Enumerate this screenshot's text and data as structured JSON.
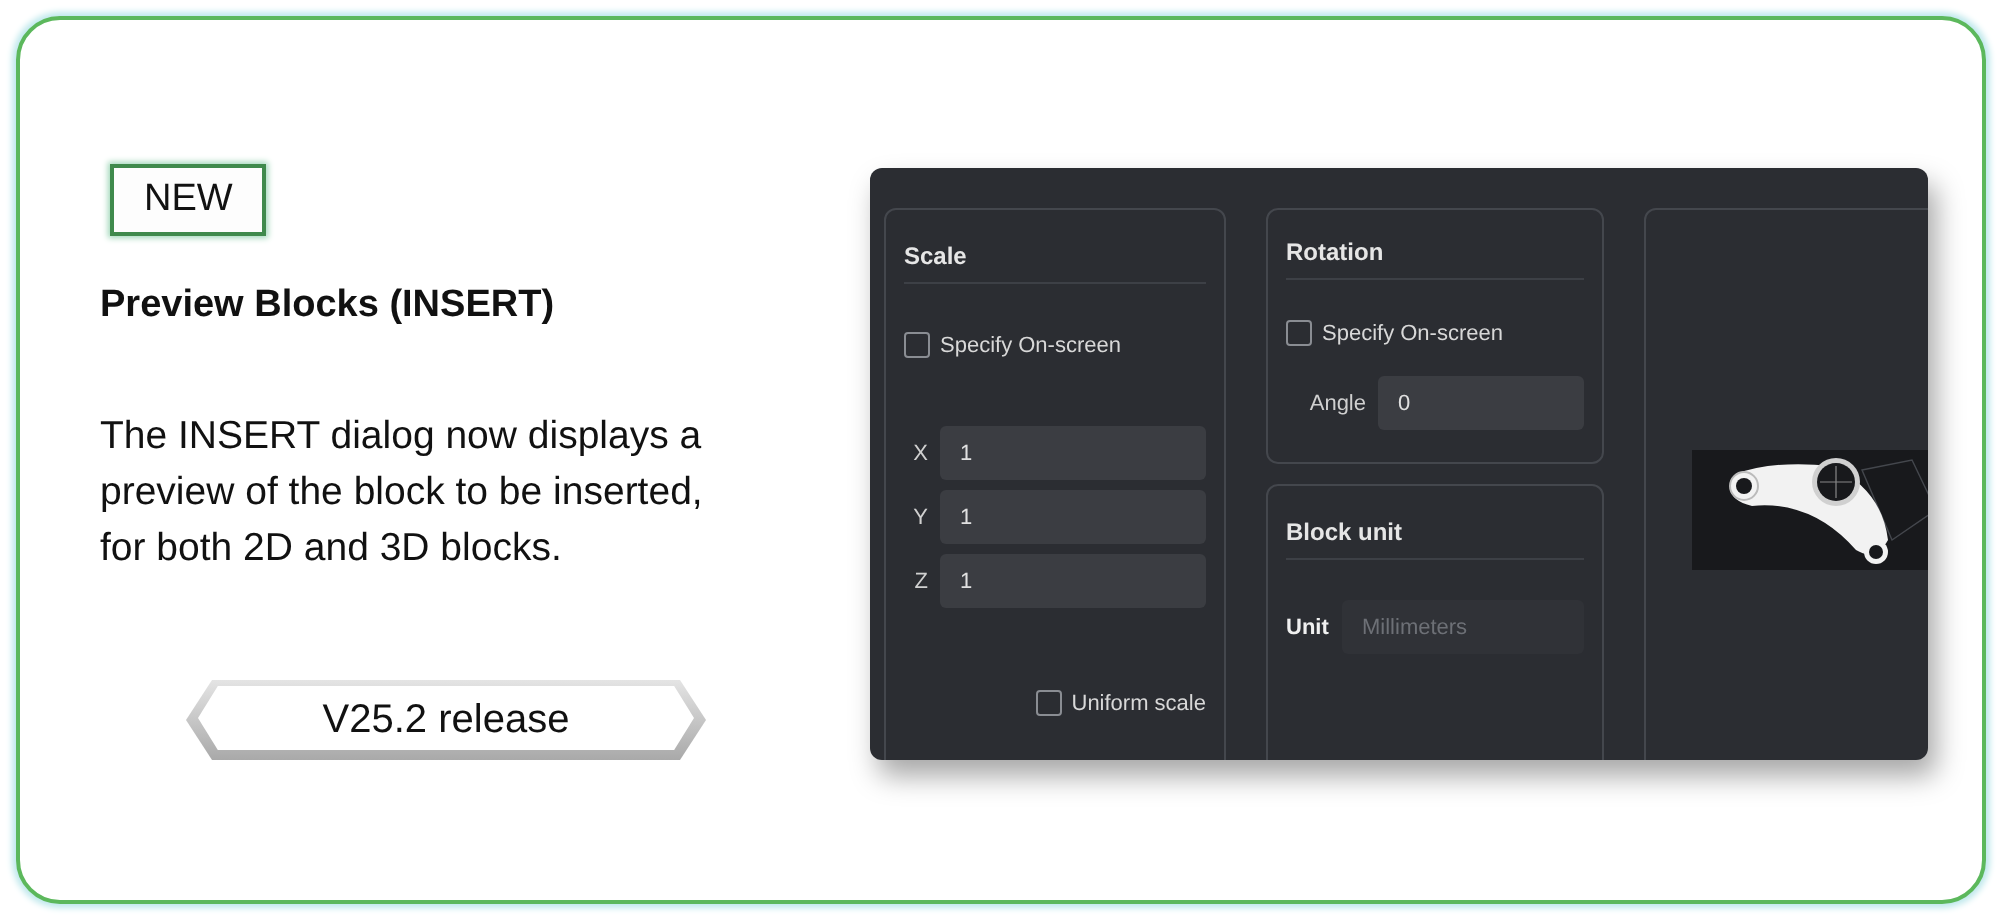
{
  "badge": "NEW",
  "title": "Preview Blocks (INSERT)",
  "description_lines": [
    "The INSERT dialog now displays a",
    "preview of the block to be inserted,",
    "for both 2D and 3D blocks."
  ],
  "release": "V25.2 release",
  "dialog": {
    "scale": {
      "title": "Scale",
      "specify_on_screen": {
        "label": "Specify On-screen",
        "checked": false
      },
      "fields": [
        {
          "label": "X",
          "value": "1"
        },
        {
          "label": "Y",
          "value": "1"
        },
        {
          "label": "Z",
          "value": "1"
        }
      ],
      "uniform_scale": {
        "label": "Uniform scale",
        "checked": false
      }
    },
    "rotation": {
      "title": "Rotation",
      "specify_on_screen": {
        "label": "Specify On-screen",
        "checked": false
      },
      "angle": {
        "label": "Angle",
        "value": "0"
      }
    },
    "block_unit": {
      "title": "Block unit",
      "unit": {
        "label": "Unit",
        "placeholder": "Millimeters"
      }
    }
  }
}
